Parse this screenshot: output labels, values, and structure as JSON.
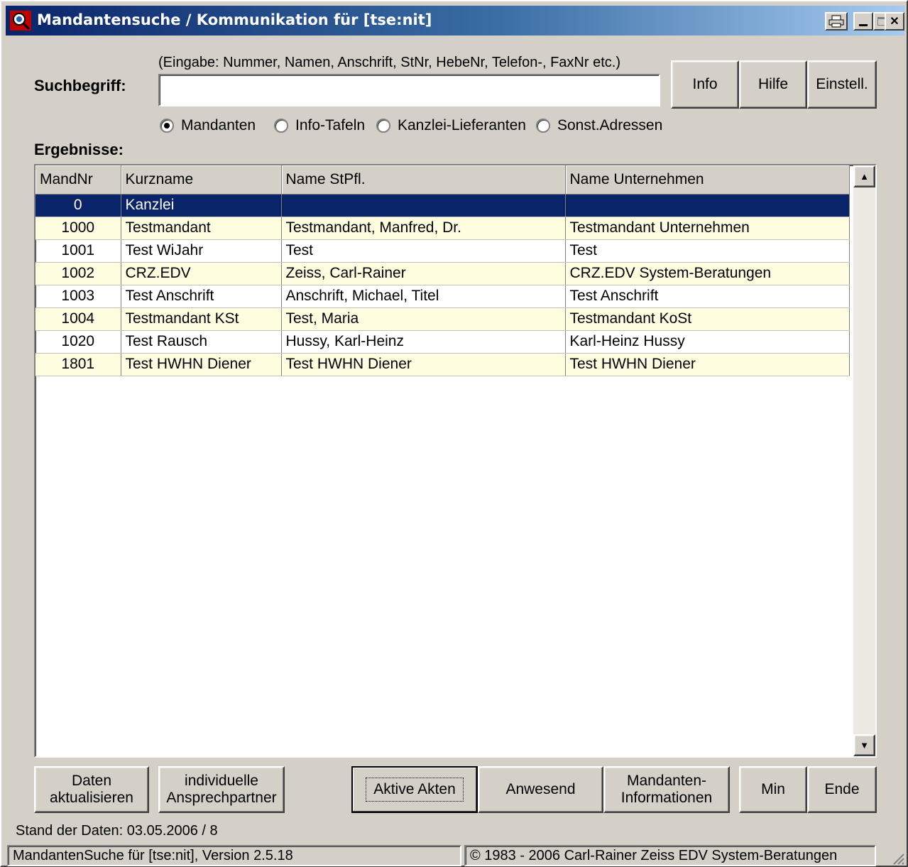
{
  "window": {
    "title": "Mandantensuche / Kommunikation für [tse:nit]"
  },
  "search": {
    "hint": "(Eingabe: Nummer, Namen, Anschrift, StNr, HebeNr, Telefon-, FaxNr etc.)",
    "label": "Suchbegriff:",
    "value": "",
    "placeholder": ""
  },
  "top_buttons": {
    "info": "Info",
    "hilfe": "Hilfe",
    "einstell": "Einstell."
  },
  "radios": {
    "options": [
      "Mandanten",
      "Info-Tafeln",
      "Kanzlei-Lieferanten",
      "Sonst.Adressen"
    ],
    "selected": "Mandanten"
  },
  "results": {
    "heading": "Ergebnisse:",
    "columns": [
      "MandNr",
      "Kurzname",
      "Name StPfl.",
      "Name Unternehmen"
    ],
    "rows": [
      [
        "0",
        "Kanzlei",
        "",
        ""
      ],
      [
        "1000",
        "Testmandant",
        "Testmandant, Manfred, Dr.",
        "Testmandant Unternehmen"
      ],
      [
        "1001",
        "Test WiJahr",
        "Test",
        "Test"
      ],
      [
        "1002",
        "CRZ.EDV",
        "Zeiss, Carl-Rainer",
        "CRZ.EDV System-Beratungen"
      ],
      [
        "1003",
        "Test Anschrift",
        "Anschrift, Michael, Titel",
        "Test Anschrift"
      ],
      [
        "1004",
        "Testmandant KSt",
        "Test, Maria",
        "Testmandant KoSt"
      ],
      [
        "1020",
        "Test Rausch",
        "Hussy, Karl-Heinz",
        "Karl-Heinz Hussy"
      ],
      [
        "1801",
        "Test HWHN Diener",
        "Test HWHN Diener",
        "Test HWHN Diener"
      ]
    ],
    "selected_index": 0
  },
  "bottom_buttons": {
    "daten_1": "Daten",
    "daten_2": "aktualisieren",
    "indiv_1": "individuelle",
    "indiv_2": "Ansprechpartner",
    "aktive": "Aktive Akten",
    "anwesend": "Anwesend",
    "mand_1": "Mandanten-",
    "mand_2": "Informationen",
    "min": "Min",
    "ende": "Ende"
  },
  "stand": "Stand der Daten: 03.05.2006 / 8",
  "status": {
    "left": "MandantenSuche für [tse:nit], Version 2.5.18",
    "right": "© 1983 - 2006 Carl-Rainer Zeiss EDV System-Beratungen"
  },
  "colors": {
    "face": "#d4d0c8",
    "selection": "#0a246a",
    "alt_row": "#fffde0",
    "title_gradient_start": "#0a246a"
  }
}
